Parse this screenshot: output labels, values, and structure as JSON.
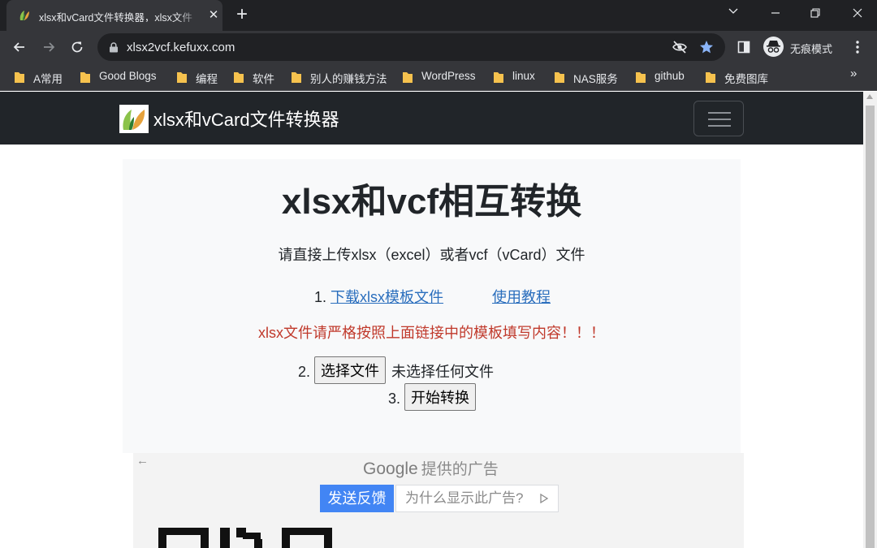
{
  "browser": {
    "tab_title": "xlsx和vCard文件转换器，xlsx文件",
    "url": "xlsx2vcf.kefuxx.com",
    "incognito_label": "无痕模式",
    "bookmarks": [
      {
        "label": "A常用"
      },
      {
        "label": "Good Blogs"
      },
      {
        "label": "编程"
      },
      {
        "label": "软件"
      },
      {
        "label": "别人的赚钱方法"
      },
      {
        "label": "WordPress"
      },
      {
        "label": "linux"
      },
      {
        "label": "NAS服务"
      },
      {
        "label": "github"
      },
      {
        "label": "免费图库"
      }
    ],
    "more_bookmarks": "»",
    "colors": {
      "tab_active": "#35363a",
      "frame": "#202124",
      "star": "#8ab4f8"
    }
  },
  "page": {
    "brand": "xlsx和vCard文件转换器",
    "title": "xlsx和vcf相互转换",
    "lead": "请直接上传xlsx（excel）或者vcf（vCard）文件",
    "step1_number": "1.",
    "template_link": "下载xlsx模板文件",
    "tutorial_link": "使用教程",
    "warning": "xlsx文件请严格按照上面链接中的模板填写内容！！！",
    "step2_number": "2.",
    "choose_file_button": "选择文件",
    "no_file_text": "未选择任何文件",
    "step3_number": "3.",
    "convert_button": "开始转换",
    "colors": {
      "navbar": "#212529",
      "link": "#2a6ebd",
      "warning": "#c0392b"
    }
  },
  "ad": {
    "provider": "Google",
    "provider_suffix": "提供的广告",
    "feedback_button": "发送反馈",
    "why_button": "为什么显示此广告?"
  }
}
